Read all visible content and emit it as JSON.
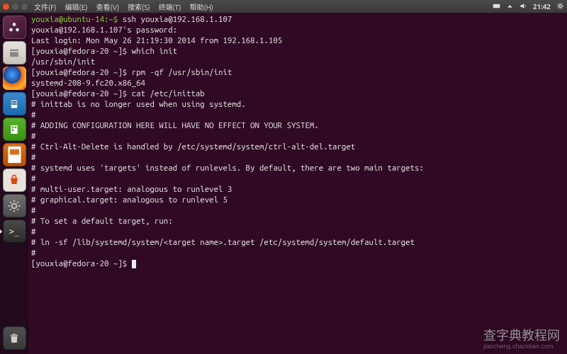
{
  "menubar": {
    "menus": [
      "文件(F)",
      "编辑(E)",
      "查看(V)",
      "搜索(S)",
      "终端(T)",
      "帮助(H)"
    ],
    "clock": "21:42"
  },
  "launcher": {
    "items": [
      {
        "name": "dash-icon"
      },
      {
        "name": "files-icon"
      },
      {
        "name": "firefox-icon"
      },
      {
        "name": "writer-icon"
      },
      {
        "name": "calc-icon"
      },
      {
        "name": "impress-icon"
      },
      {
        "name": "software-center-icon"
      },
      {
        "name": "settings-icon"
      },
      {
        "name": "terminal-icon"
      }
    ],
    "trash": "trash-icon"
  },
  "terminal": {
    "lines": [
      {
        "prompt": "youxia@ubuntu-14:~$",
        "cmd": " ssh youxia@192.168.1.107",
        "style": "local"
      },
      {
        "text": "youxia@192.168.1.107's password:"
      },
      {
        "text": "Last login: Mon May 26 21:19:30 2014 from 192.168.1.105"
      },
      {
        "prompt": "[youxia@fedora-20 ~]$",
        "cmd": " which init",
        "style": "remote"
      },
      {
        "text": "/usr/sbin/init"
      },
      {
        "prompt": "[youxia@fedora-20 ~]$",
        "cmd": " rpm -qf /usr/sbin/init",
        "style": "remote"
      },
      {
        "text": "systemd-208-9.fc20.x86_64"
      },
      {
        "prompt": "[youxia@fedora-20 ~]$",
        "cmd": " cat /etc/inittab",
        "style": "remote"
      },
      {
        "text": "# inittab is no longer used when using systemd."
      },
      {
        "text": "#"
      },
      {
        "text": "# ADDING CONFIGURATION HERE WILL HAVE NO EFFECT ON YOUR SYSTEM."
      },
      {
        "text": "#"
      },
      {
        "text": "# Ctrl-Alt-Delete is handled by /etc/systemd/system/ctrl-alt-del.target"
      },
      {
        "text": "#"
      },
      {
        "text": "# systemd uses 'targets' instead of runlevels. By default, there are two main targets:"
      },
      {
        "text": "#"
      },
      {
        "text": "# multi-user.target: analogous to runlevel 3"
      },
      {
        "text": "# graphical.target: analogous to runlevel 5"
      },
      {
        "text": "#"
      },
      {
        "text": "# To set a default target, run:"
      },
      {
        "text": "#"
      },
      {
        "text": "# ln -sf /lib/systemd/system/<target name>.target /etc/systemd/system/default.target"
      },
      {
        "text": "#"
      },
      {
        "prompt": "[youxia@fedora-20 ~]$",
        "cmd": "",
        "style": "remote",
        "cursor": true
      }
    ]
  },
  "watermark": {
    "main": "查字典教程网",
    "sub": "jiaocheng.chazidian.com"
  }
}
